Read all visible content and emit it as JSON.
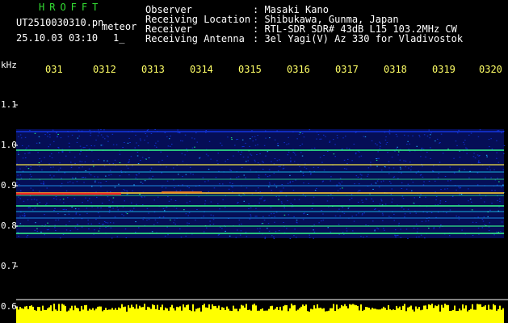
{
  "brand": "HROFFT",
  "file_name": "UT2510030310.pn",
  "file_suffix": "meteor",
  "datetime": "25.10.03 03:10",
  "counter": "1_",
  "info": {
    "observer_label": "Observer",
    "observer_value": ": Masaki Kano",
    "location_label": "Receiving Location",
    "location_value": ": Shibukawa, Gunma, Japan",
    "receiver_label": "Receiver",
    "receiver_value": ": RTL-SDR SDR# 43dB L15 103.2MHz CW",
    "antenna_label": "Receiving Antenna",
    "antenna_value": ": 3el Yagi(V) Az 330 for Vladivostok"
  },
  "y_axis": {
    "unit": "kHz",
    "ticks": [
      "1.1",
      "1.0",
      "0.9",
      "0.8",
      "0.7",
      "0.6"
    ]
  },
  "x_axis": {
    "ticks": [
      "031",
      "0312",
      "0313",
      "0314",
      "0315",
      "0316",
      "0317",
      "0318",
      "0319",
      "0320"
    ]
  },
  "colors": {
    "background": "#000000",
    "noise": "#0a1a9c",
    "signal_hot": "#ff2020",
    "amplitude_bar": "#ffff00"
  }
}
